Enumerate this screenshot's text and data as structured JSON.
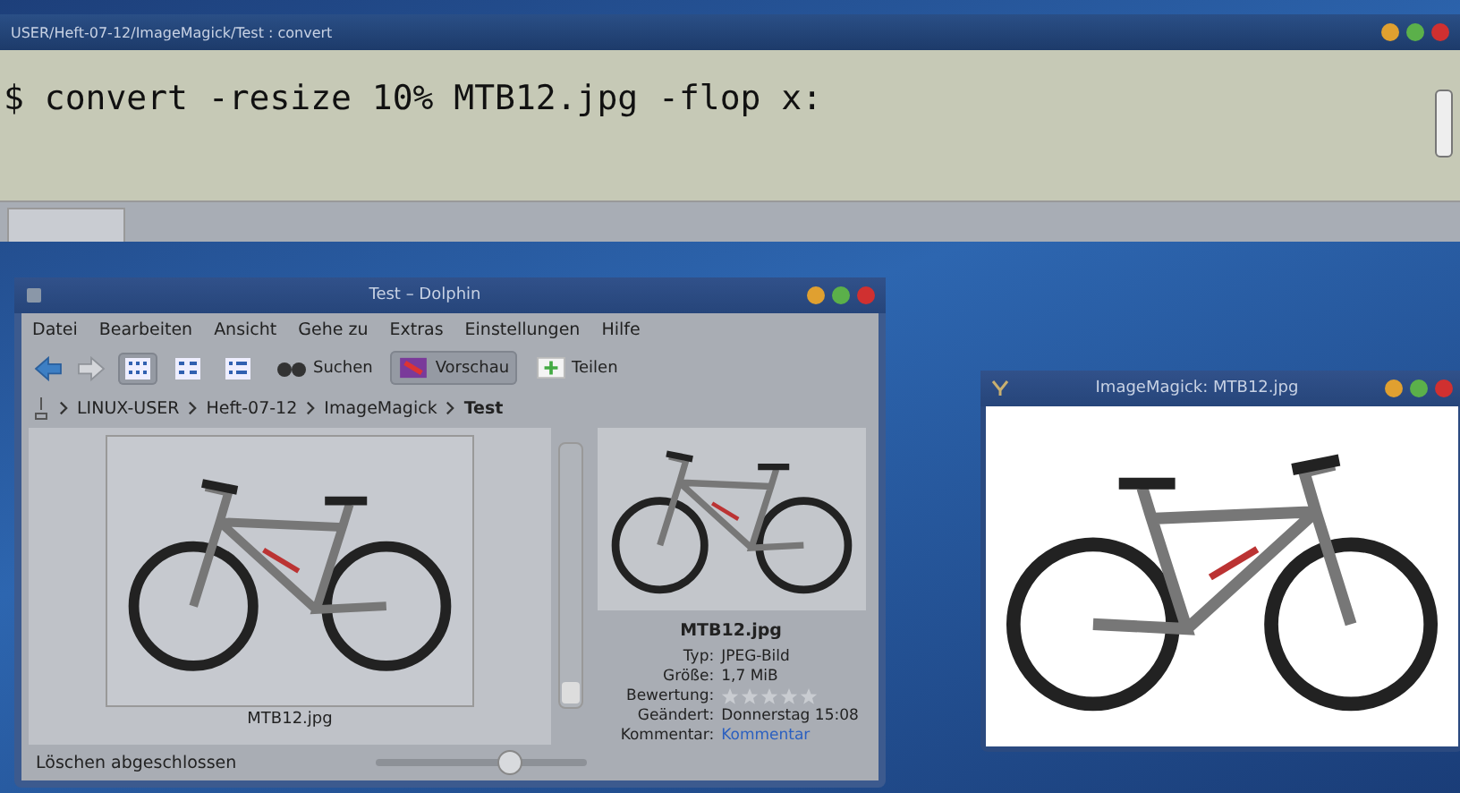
{
  "terminal": {
    "title": "USER/Heft-07-12/ImageMagick/Test : convert",
    "command": "$ convert -resize 10% MTB12.jpg -flop x:"
  },
  "dolphin": {
    "title": "Test – Dolphin",
    "menu": [
      "Datei",
      "Bearbeiten",
      "Ansicht",
      "Gehe zu",
      "Extras",
      "Einstellungen",
      "Hilfe"
    ],
    "nav": [
      {
        "kind": "back",
        "disabled": false
      },
      {
        "kind": "forward",
        "disabled": true
      }
    ],
    "view_modes": [
      {
        "selected": true
      },
      {
        "selected": false
      },
      {
        "selected": false
      }
    ],
    "actions": [
      {
        "kind": "search",
        "label": "Suchen",
        "selected": false
      },
      {
        "kind": "preview",
        "label": "Vorschau",
        "selected": true
      },
      {
        "kind": "share",
        "label": "Teilen",
        "selected": false
      }
    ],
    "breadcrumb": [
      {
        "label": "LINUX-USER",
        "current": false
      },
      {
        "label": "Heft-07-12",
        "current": false
      },
      {
        "label": "ImageMagick",
        "current": false
      },
      {
        "label": "Test",
        "current": true
      }
    ],
    "file": {
      "name": "MTB12.jpg"
    },
    "info": {
      "name": "MTB12.jpg",
      "fields": [
        {
          "kind": "text",
          "label": "Typ:",
          "value": "JPEG-Bild"
        },
        {
          "kind": "text",
          "label": "Größe:",
          "value": "1,7 MiB"
        },
        {
          "kind": "rating",
          "label": "Bewertung:",
          "stars": 0
        },
        {
          "kind": "text",
          "label": "Geändert:",
          "value": "Donnerstag 15:08"
        },
        {
          "kind": "link",
          "label": "Kommentar:",
          "value": "Kommentar"
        }
      ]
    },
    "status": {
      "message": "Löschen abgeschlossen",
      "zoom": {
        "level": 0.65
      }
    }
  },
  "imagemagick": {
    "title": "ImageMagick: MTB12.jpg"
  }
}
